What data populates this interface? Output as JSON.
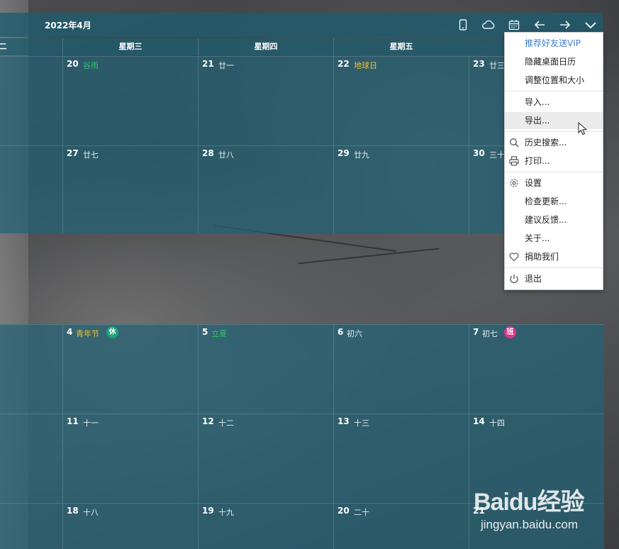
{
  "header": {
    "month_title": "2022年4月",
    "icons": [
      "mobile-icon",
      "cloud-icon",
      "calendar-icon",
      "arrow-left-icon",
      "arrow-right-icon",
      "chevron-down-icon"
    ]
  },
  "weekdays": [
    "二",
    "星期三",
    "星期四",
    "星期五"
  ],
  "week1": [
    {
      "day": "20",
      "lunar": "谷雨"
    },
    {
      "day": "21",
      "lunar": "廿一"
    },
    {
      "day": "22",
      "lunar": "地球日"
    },
    {
      "day": "23",
      "lunar": "廿三"
    }
  ],
  "week2": [
    {
      "day": "27",
      "lunar": "廿七"
    },
    {
      "day": "28",
      "lunar": "廿八"
    },
    {
      "day": "29",
      "lunar": "廿九"
    },
    {
      "day": "30",
      "lunar": "三十"
    }
  ],
  "week3": [
    {
      "day": "4",
      "lunar": "青年节",
      "badge": "休"
    },
    {
      "day": "5",
      "lunar": "立夏"
    },
    {
      "day": "6",
      "lunar": "初六"
    },
    {
      "day": "7",
      "lunar": "初七",
      "badge": "班"
    }
  ],
  "week4": [
    {
      "day": "11",
      "lunar": "十一"
    },
    {
      "day": "12",
      "lunar": "十二"
    },
    {
      "day": "13",
      "lunar": "十三"
    },
    {
      "day": "14",
      "lunar": "十四"
    }
  ],
  "week5": [
    {
      "day": "18",
      "lunar": "十八"
    },
    {
      "day": "19",
      "lunar": "十九"
    },
    {
      "day": "20",
      "lunar": "二十"
    },
    {
      "day": "21",
      "lunar": ""
    }
  ],
  "menu": {
    "items": [
      {
        "label": "推荐好友送VIP"
      },
      {
        "label": "隐藏桌面日历"
      },
      {
        "label": "调整位置和大小"
      },
      {
        "label": "导入..."
      },
      {
        "label": "导出..."
      },
      {
        "label": "历史搜索...",
        "icon": "search-icon"
      },
      {
        "label": "打印...",
        "icon": "printer-icon"
      },
      {
        "label": "设置",
        "icon": "gear-icon"
      },
      {
        "label": "检查更新..."
      },
      {
        "label": "建议反馈..."
      },
      {
        "label": "关于..."
      },
      {
        "label": "捐助我们",
        "icon": "heart-icon"
      },
      {
        "label": "退出",
        "icon": "power-icon"
      }
    ]
  },
  "colors": {
    "accent_green": "#2fc46a",
    "accent_yellow": "#f0c232",
    "badge_rest": "#1aa37a",
    "badge_work": "#e0338a",
    "vip_link": "#3f7fd0"
  },
  "watermark": {
    "logo": "Baidu经验",
    "site": "jingyan.baidu.com"
  }
}
